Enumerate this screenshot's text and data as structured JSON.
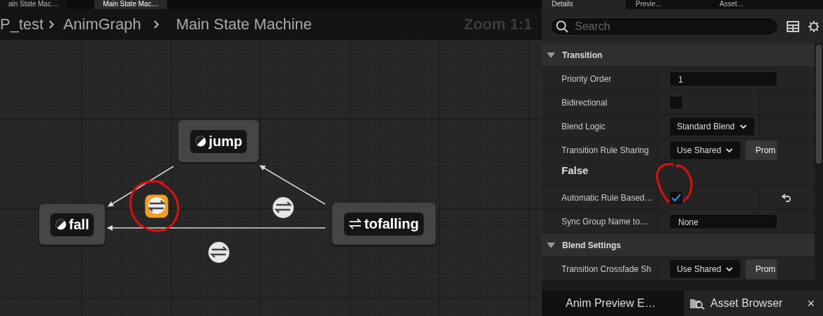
{
  "editor_tabs": [
    {
      "label": "ain State Mac…",
      "selected": false
    },
    {
      "label": "Main State Mac…",
      "selected": true
    }
  ],
  "breadcrumb": [
    "P_test",
    "AnimGraph",
    "Main State Machine"
  ],
  "zoom_label": "Zoom 1:1",
  "graph": {
    "nodes": [
      {
        "label": "jump",
        "kind": "state"
      },
      {
        "label": "fall",
        "kind": "state"
      },
      {
        "label": "tofalling",
        "kind": "conduit"
      }
    ],
    "transitions": [
      {
        "selected": true
      },
      {
        "selected": false
      },
      {
        "selected": false
      }
    ]
  },
  "panel_tabs": [
    {
      "label": "Details",
      "selected": true
    },
    {
      "label": "Previe…",
      "selected": false
    },
    {
      "label": "Asset…",
      "selected": false
    }
  ],
  "search": {
    "placeholder": "Search"
  },
  "sections": [
    {
      "title": "Transition",
      "expanded": true,
      "rows": [
        {
          "kind": "number",
          "label": "Priority Order",
          "value": "1"
        },
        {
          "kind": "checkbox",
          "label": "Bidirectional",
          "checked": false
        },
        {
          "kind": "dropdown",
          "label": "Blend Logic",
          "value": "Standard Blend"
        },
        {
          "kind": "dropdown_button",
          "label": "Transition Rule Sharing",
          "value": "Use Shared",
          "button": "Prom"
        },
        {
          "kind": "note",
          "label": "False"
        },
        {
          "kind": "checkbox",
          "label": "Automatic Rule Based…",
          "checked": true,
          "resettable": true
        },
        {
          "kind": "text",
          "label": "Sync Group Name to…",
          "value": "None"
        }
      ]
    },
    {
      "title": "Blend Settings",
      "expanded": true,
      "rows": [
        {
          "kind": "dropdown_button",
          "label": "Transition Crossfade Sh",
          "value": "Use Shared",
          "button": "Prom"
        }
      ]
    }
  ],
  "bottom_tabs": [
    {
      "label": "Anim Preview E…",
      "selected": false
    },
    {
      "label": "Asset Browser",
      "selected": true,
      "closable": true
    }
  ],
  "close_label": "×"
}
